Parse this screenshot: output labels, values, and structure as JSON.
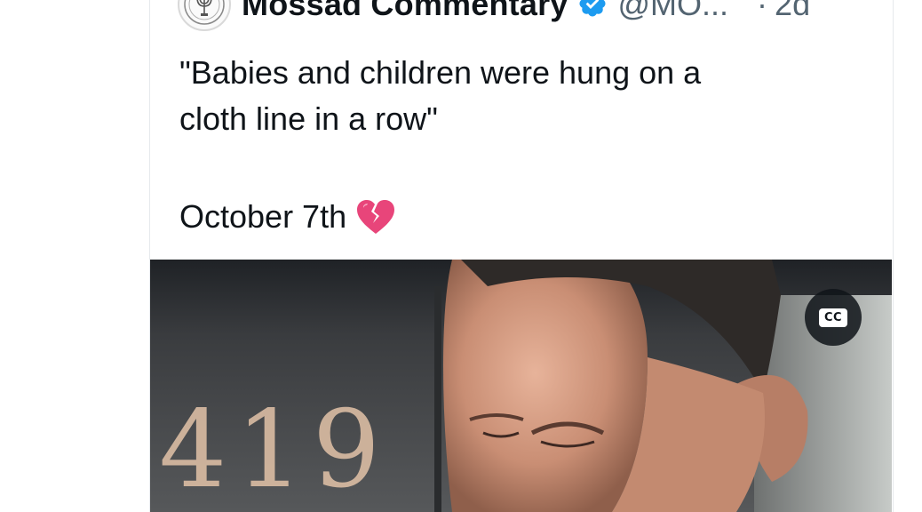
{
  "post": {
    "author_name": "Mossad Commentary",
    "handle": "@MO...",
    "separator": "·",
    "time_ago": "2d",
    "text": "\"Babies and children were hung on a\ncloth line in a row\"",
    "date_line": "October 7th",
    "date_emoji_icon": "broken-heart-icon"
  },
  "media": {
    "painted_numbers": "419",
    "cc_label": "CC"
  },
  "colors": {
    "verified_badge": "#1d9bf0",
    "text_primary": "#0f1419",
    "text_secondary": "#536471",
    "broken_heart": "#e8457a"
  }
}
